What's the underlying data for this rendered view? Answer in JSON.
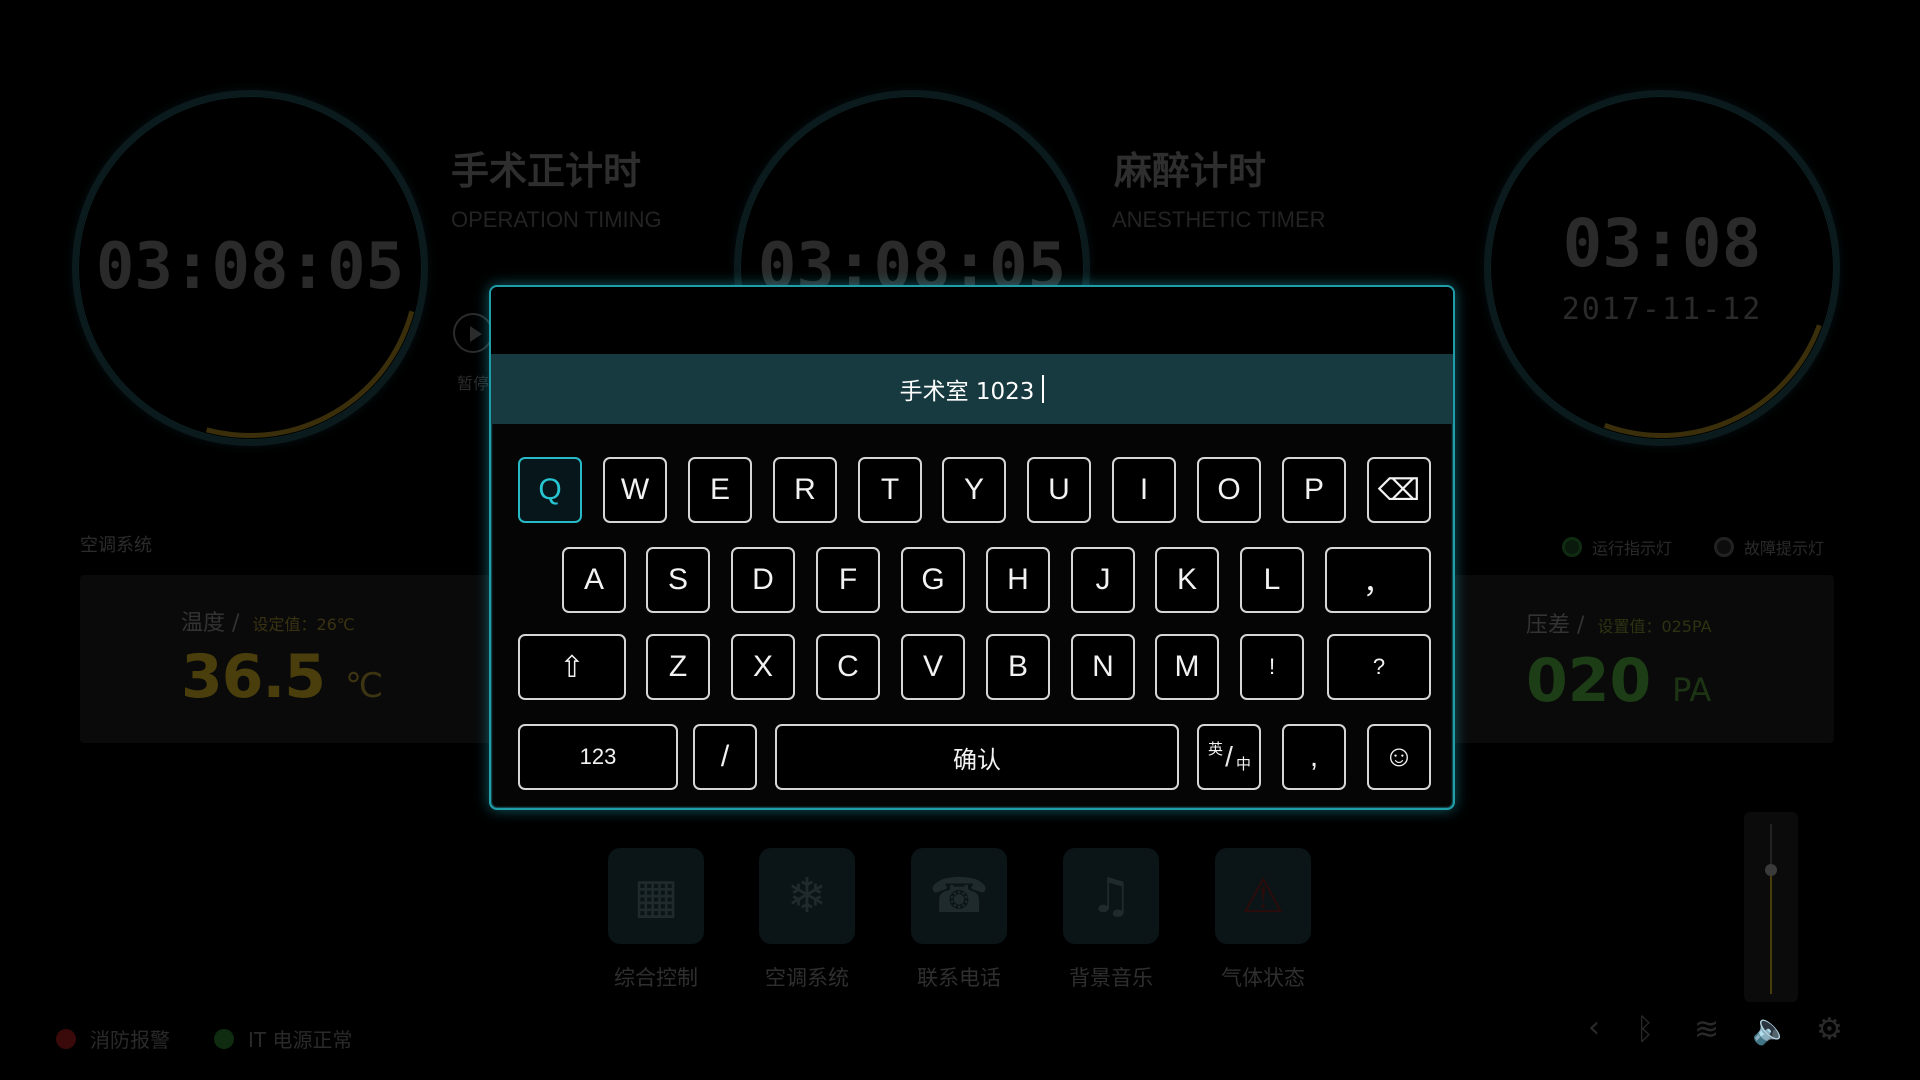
{
  "timers": {
    "operation": {
      "time": "03:08:05",
      "title_cn": "手术正计时",
      "title_en": "OPERATION TIMING",
      "pause_label": "暂停"
    },
    "anesthesia": {
      "time": "03:08:05",
      "title_cn": "麻醉计时",
      "title_en": "ANESTHETIC TIMER"
    },
    "clock": {
      "time": "03:08",
      "date": "2017-11-12"
    }
  },
  "ac_system": {
    "section_label": "空调系统",
    "temperature": {
      "title": "温度",
      "sep": "/",
      "setting": "设定值：26℃",
      "value": "36.5",
      "unit": "℃"
    },
    "pressure": {
      "title": "压差",
      "sep": "/",
      "setting": "设置值：025PA",
      "value": "020",
      "unit": "PA"
    },
    "run_indicator": "运行指示灯",
    "fault_indicator": "故障提示灯"
  },
  "apps": [
    {
      "label": "综合控制",
      "icon": "grid-icon"
    },
    {
      "label": "空调系统",
      "icon": "air-conditioner-icon"
    },
    {
      "label": "联系电话",
      "icon": "phone-icon"
    },
    {
      "label": "背景音乐",
      "icon": "music-icon"
    },
    {
      "label": "气体状态",
      "icon": "alarm-icon"
    }
  ],
  "status": {
    "fire_alarm": {
      "label": "消防报警",
      "color": "#3a0a0a"
    },
    "it_power": {
      "label": "IT 电源正常",
      "color": "#0f2c10"
    }
  },
  "system_icons": [
    "back-icon",
    "bluetooth-icon",
    "wifi-icon",
    "volume-icon",
    "settings-icon"
  ],
  "keyboard": {
    "input_value": "手术室 1023",
    "rows": [
      [
        "Q",
        "W",
        "E",
        "R",
        "T",
        "Y",
        "U",
        "I",
        "O",
        "P"
      ],
      [
        "A",
        "S",
        "D",
        "F",
        "G",
        "H",
        "J",
        "K",
        "L",
        "，"
      ],
      [
        "Z",
        "X",
        "C",
        "V",
        "B",
        "N",
        "M",
        "!",
        "?"
      ]
    ],
    "backspace_icon": "⌫",
    "shift_icon": "⇧",
    "numbers_label": "123",
    "slash_label": "/",
    "confirm_label": "确认",
    "lang_toggle": {
      "primary": "英",
      "secondary": "中"
    },
    "comma_label": ",",
    "emoji_icon": "☺",
    "active_key": "Q"
  },
  "volume_level": 0.7
}
